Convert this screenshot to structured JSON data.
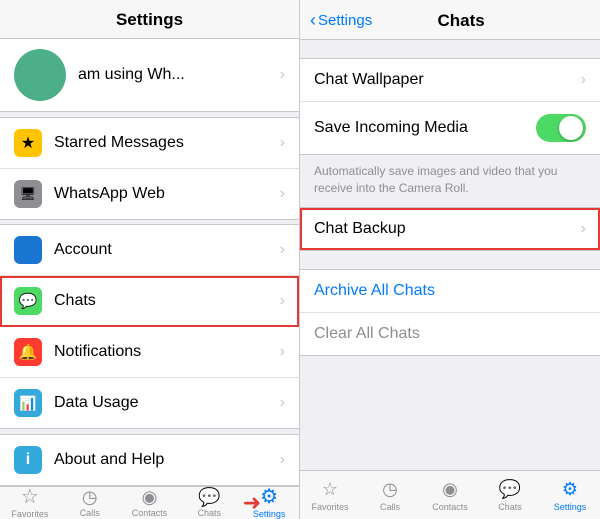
{
  "left": {
    "header": "Settings",
    "profile": {
      "status": "am using Wh..."
    },
    "groups": [
      {
        "items": [
          {
            "id": "starred",
            "label": "Starred Messages",
            "iconColor": "yellow",
            "icon": "★"
          },
          {
            "id": "whatsapp-web",
            "label": "WhatsApp Web",
            "iconColor": "gray",
            "icon": "🖥"
          }
        ]
      },
      {
        "items": [
          {
            "id": "account",
            "label": "Account",
            "iconColor": "blue",
            "icon": "👤",
            "highlighted": false
          },
          {
            "id": "chats",
            "label": "Chats",
            "iconColor": "green",
            "icon": "💬",
            "highlighted": true
          },
          {
            "id": "notifications",
            "label": "Notifications",
            "iconColor": "orange",
            "icon": "🔔"
          },
          {
            "id": "data-usage",
            "label": "Data Usage",
            "iconColor": "teal",
            "icon": "📊"
          }
        ]
      },
      {
        "items": [
          {
            "id": "about",
            "label": "About and Help",
            "iconColor": "info",
            "icon": "ℹ"
          }
        ]
      }
    ],
    "tabs": [
      {
        "id": "favorites",
        "label": "Favorites",
        "icon": "☆",
        "active": false
      },
      {
        "id": "calls",
        "label": "Calls",
        "icon": "○",
        "active": false
      },
      {
        "id": "contacts",
        "label": "Contacts",
        "icon": "◎",
        "active": false
      },
      {
        "id": "chats",
        "label": "Chats",
        "icon": "💬",
        "active": false
      },
      {
        "id": "settings",
        "label": "Settings",
        "icon": "⚙",
        "active": true
      }
    ]
  },
  "right": {
    "back_label": "Settings",
    "title": "Chats",
    "items_group1": [
      {
        "id": "chat-wallpaper",
        "label": "Chat Wallpaper"
      },
      {
        "id": "save-media",
        "label": "Save Incoming Media",
        "has_toggle": true
      }
    ],
    "description": "Automatically save images and video that you receive into the Camera Roll.",
    "items_group2": [
      {
        "id": "chat-backup",
        "label": "Chat Backup",
        "highlighted": true
      }
    ],
    "items_group3": [
      {
        "id": "archive-all",
        "label": "Archive All Chats",
        "is_link": true
      },
      {
        "id": "clear-all",
        "label": "Clear All Chats",
        "is_muted": true
      }
    ],
    "tabs": [
      {
        "id": "favorites",
        "label": "Favorites",
        "icon": "☆",
        "active": false
      },
      {
        "id": "calls",
        "label": "Calls",
        "icon": "○",
        "active": false
      },
      {
        "id": "contacts",
        "label": "Contacts",
        "icon": "◎",
        "active": false
      },
      {
        "id": "chats",
        "label": "Chats",
        "icon": "💬",
        "active": false
      },
      {
        "id": "settings",
        "label": "Settings",
        "icon": "⚙",
        "active": true
      }
    ]
  }
}
